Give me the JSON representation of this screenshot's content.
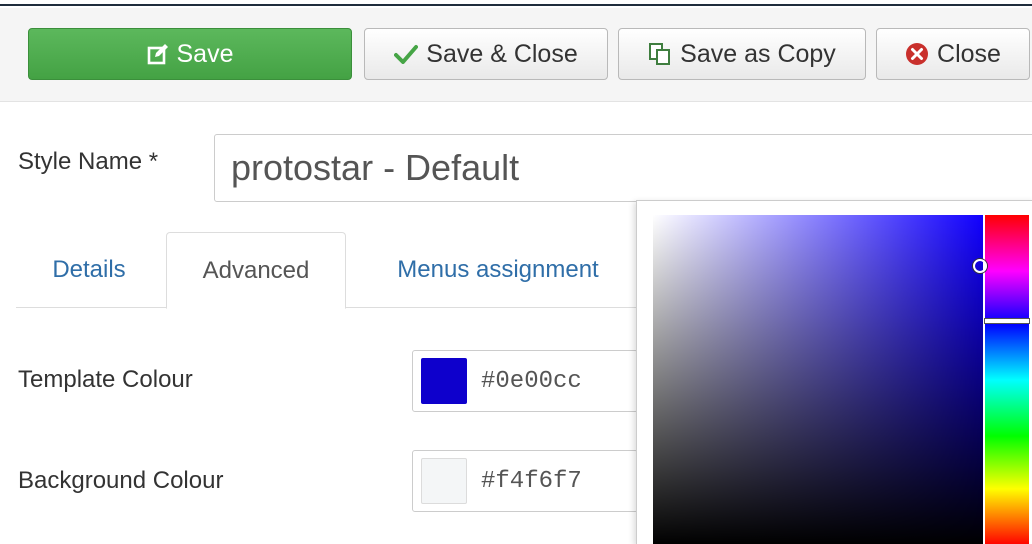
{
  "toolbar": {
    "save_label": "Save",
    "save_close_label": "Save & Close",
    "save_copy_label": "Save as Copy",
    "close_label": "Close"
  },
  "icons": {
    "save": "edit-icon",
    "save_close": "checkmark-icon",
    "save_copy": "copy-icon",
    "close": "close-circle-icon"
  },
  "form": {
    "style_name_label": "Style Name *",
    "style_name_value": "protostar - Default"
  },
  "tabs": [
    {
      "label": "Details",
      "active": false
    },
    {
      "label": "Advanced",
      "active": true
    },
    {
      "label": "Menus assignment",
      "active": false
    }
  ],
  "fields": {
    "template_colour": {
      "label": "Template Colour",
      "value": "#0e00cc"
    },
    "background_colour": {
      "label": "Background Colour",
      "value": "#f4f6f7"
    }
  },
  "colors": {
    "save_green": "#5cb85c",
    "link_blue": "#2f6ea8",
    "picker_hue": "#1100ff"
  }
}
